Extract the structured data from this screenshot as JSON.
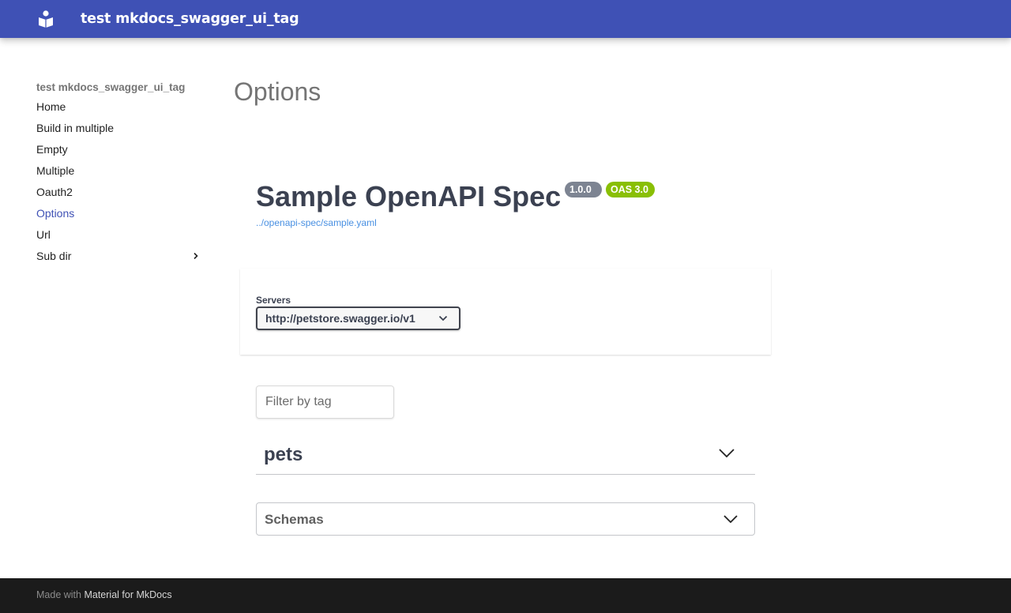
{
  "header": {
    "site_title": "test mkdocs_swagger_ui_tag",
    "logo_icon": "book-open-icon",
    "color": "#3f51b5"
  },
  "sidebar": {
    "title": "test mkdocs_swagger_ui_tag",
    "items": [
      {
        "label": "Home",
        "active": false
      },
      {
        "label": "Build in multiple",
        "active": false
      },
      {
        "label": "Empty",
        "active": false
      },
      {
        "label": "Multiple",
        "active": false
      },
      {
        "label": "Oauth2",
        "active": false
      },
      {
        "label": "Options",
        "active": true
      },
      {
        "label": "Url",
        "active": false
      },
      {
        "label": "Sub dir",
        "active": false,
        "has_children": true
      }
    ],
    "active_color": "#3f51b5"
  },
  "main": {
    "page_title": "Options",
    "spec": {
      "title": "Sample OpenAPI Spec",
      "version_badge": "1.0.0",
      "oas_badge": "OAS 3.0",
      "link": "../openapi-spec/sample.yaml"
    },
    "servers": {
      "label": "Servers",
      "selected": "http://petstore.swagger.io/v1"
    },
    "filter": {
      "placeholder": "Filter by tag"
    },
    "tags": [
      {
        "name": "pets",
        "expanded": false
      }
    ],
    "schemas": {
      "label": "Schemas",
      "expanded": false
    }
  },
  "footer": {
    "prefix": "Made with",
    "link_text": "Material for MkDocs"
  }
}
